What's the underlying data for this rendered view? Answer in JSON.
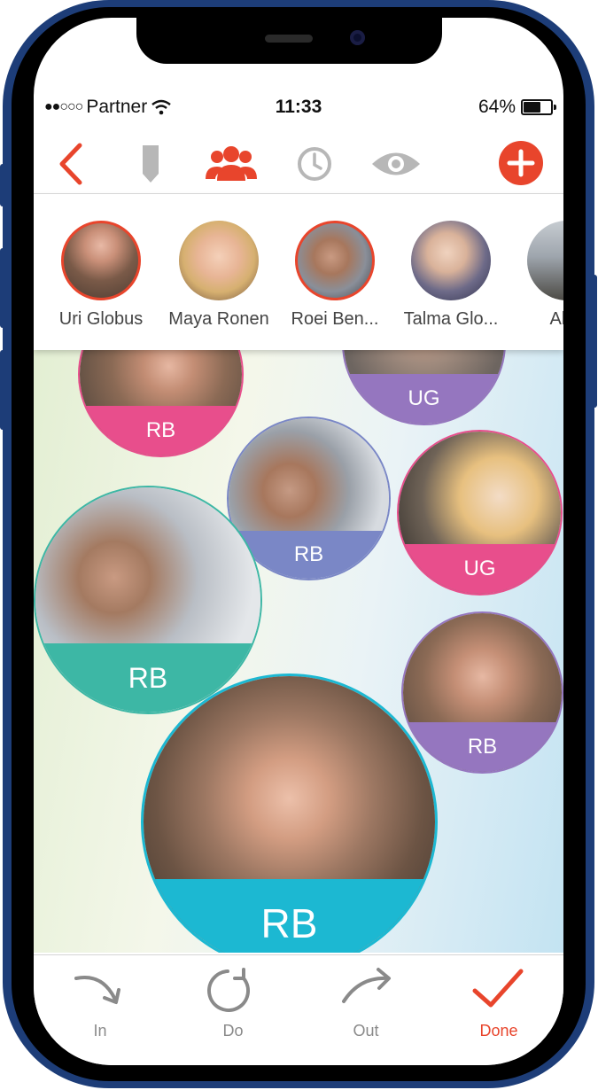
{
  "status_bar": {
    "carrier": "Partner",
    "time": "11:33",
    "battery_percent": "64%",
    "battery_level": 0.64
  },
  "toolbar": {
    "icons": [
      "chevron-left-icon",
      "pin-icon",
      "group-icon",
      "clock-icon",
      "eye-icon",
      "plus-circle-icon"
    ],
    "accent_color": "#e8452c",
    "inactive_color": "#b7b7b7"
  },
  "contacts": [
    {
      "name": "Uri Globus"
    },
    {
      "name": "Maya Ronen"
    },
    {
      "name": "Roei Ben..."
    },
    {
      "name": "Talma Glo..."
    },
    {
      "name": "Alex"
    }
  ],
  "bubbles": [
    {
      "initials": "RB",
      "color": "#e84e8c"
    },
    {
      "initials": "UG",
      "color": "#9576bf"
    },
    {
      "initials": "RB",
      "color": "#7a87c6"
    },
    {
      "initials": "UG",
      "color": "#e84e8c"
    },
    {
      "initials": "RB",
      "color": "#3db7a5"
    },
    {
      "initials": "RB",
      "color": "#9576bf"
    },
    {
      "initials": "RB",
      "color": "#1cb8d2"
    }
  ],
  "bottom_bar": {
    "in_label": "In",
    "do_label": "Do",
    "out_label": "Out",
    "done_label": "Done",
    "done_color": "#e8452c"
  }
}
